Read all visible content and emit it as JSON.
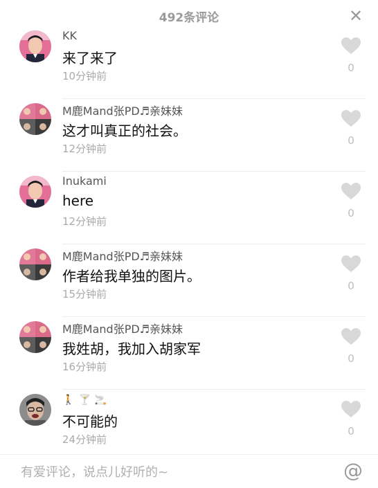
{
  "header": {
    "title": "492条评论"
  },
  "comments": [
    {
      "username": "KK",
      "text": "来了来了",
      "time": "10分钟前",
      "likes": "0"
    },
    {
      "username": "M鹿Mand张PD♬亲妹妹",
      "text": "这才叫真正的社会。",
      "time": "12分钟前",
      "likes": "0"
    },
    {
      "username": "Inukami",
      "text": "here",
      "time": "12分钟前",
      "likes": "0"
    },
    {
      "username": "M鹿Mand张PD♬亲妹妹",
      "text": "作者给我单独的图片。",
      "time": "15分钟前",
      "likes": "0"
    },
    {
      "username": "M鹿Mand张PD♬亲妹妹",
      "text": "我姓胡，我加入胡家军",
      "time": "16分钟前",
      "likes": "0"
    },
    {
      "username": "",
      "username_emojis": [
        "🚶",
        "🍸",
        "🚬"
      ],
      "text": "不可能的",
      "time": "24分钟前",
      "likes": "0"
    }
  ],
  "footer": {
    "placeholder": "有爱评论，说点儿好听的~",
    "at_symbol": "@"
  },
  "colors": {
    "muted": "#9a9a9a",
    "divider": "#ececec",
    "heart": "#d8d8d8"
  }
}
